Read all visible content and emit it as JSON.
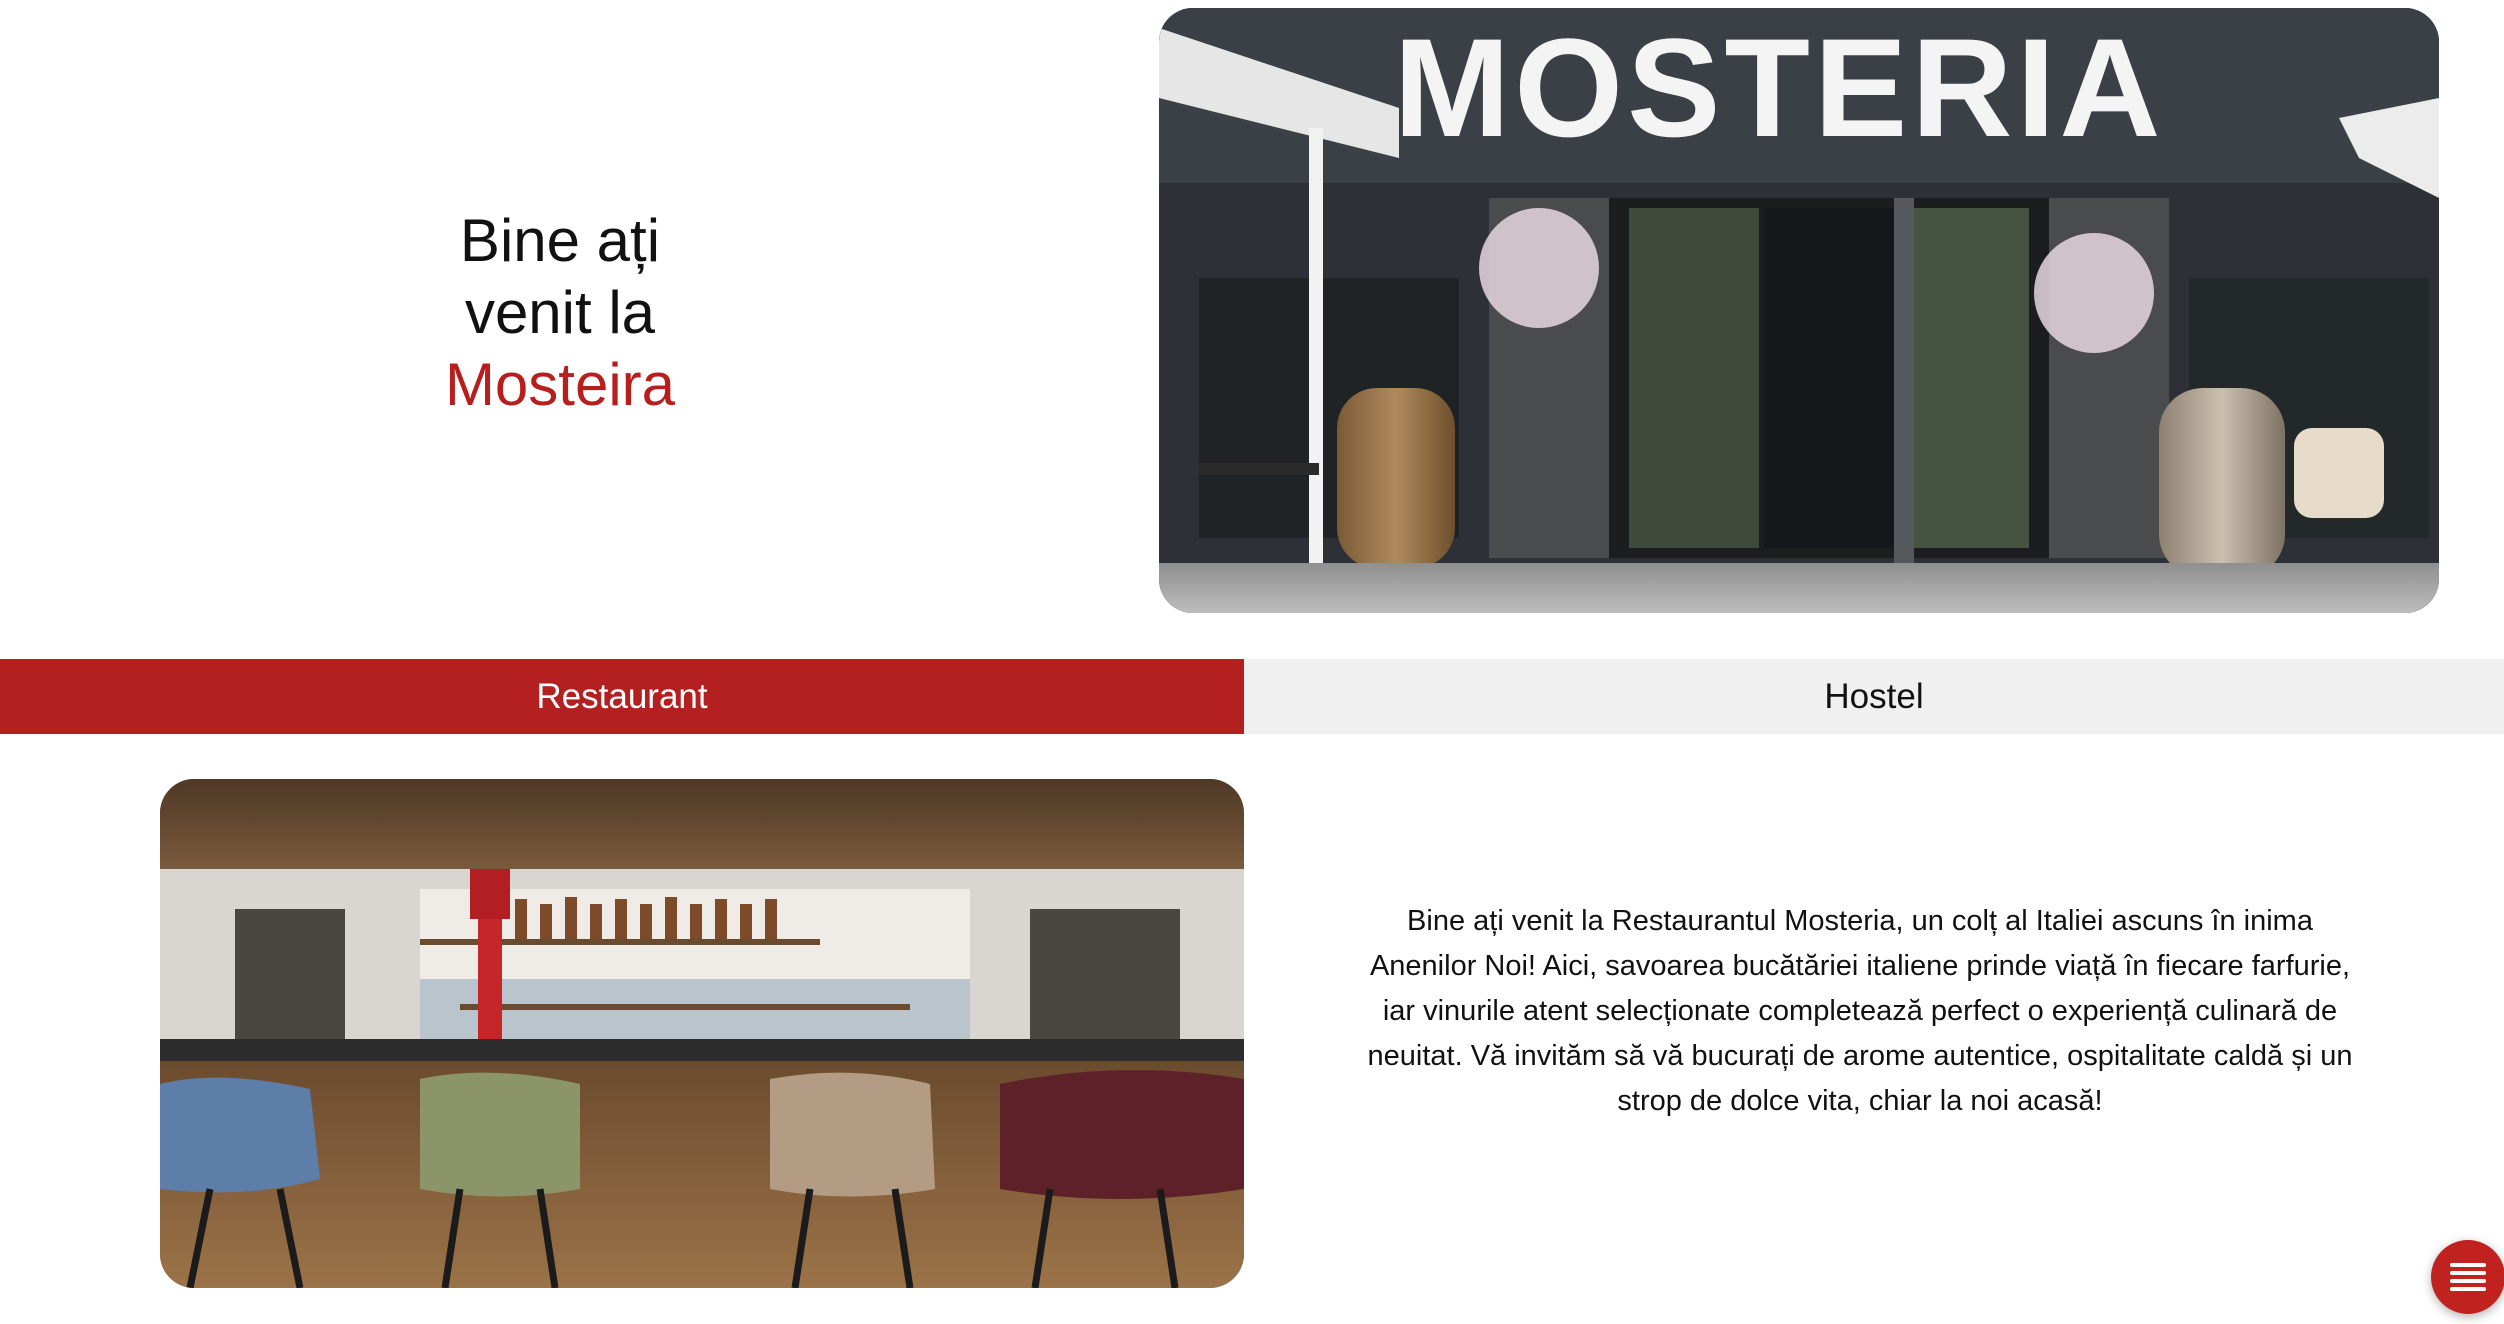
{
  "hero": {
    "title_line1": "Bine ați",
    "title_line2": "venit la",
    "brand_name": "Mosteira",
    "photo_sign": "MOSTERIA",
    "photo_alt": "Mosteria restaurant storefront"
  },
  "tabs": [
    {
      "label": "Restaurant",
      "active": true
    },
    {
      "label": "Hostel",
      "active": false
    }
  ],
  "content": {
    "bar_photo_alt": "Restaurant bar interior",
    "intro": "Bine ați venit la Restaurantul Mosteria, un colț al Italiei ascuns în inima Anenilor Noi! Aici, savoarea bucătăriei italiene prinde viață în fiecare farfurie, iar vinurile atent selecționate completează perfect o experiență culinară de neuitat. Vă invităm să vă bucurați de arome autentice, ospitalitate caldă și un strop de dolce vita, chiar la noi acasă!"
  },
  "menu_button": {
    "icon": "hamburger-menu-icon"
  },
  "colors": {
    "accent": "#b4201f",
    "tab_inactive": "#f0f0f0",
    "text": "#111111"
  }
}
